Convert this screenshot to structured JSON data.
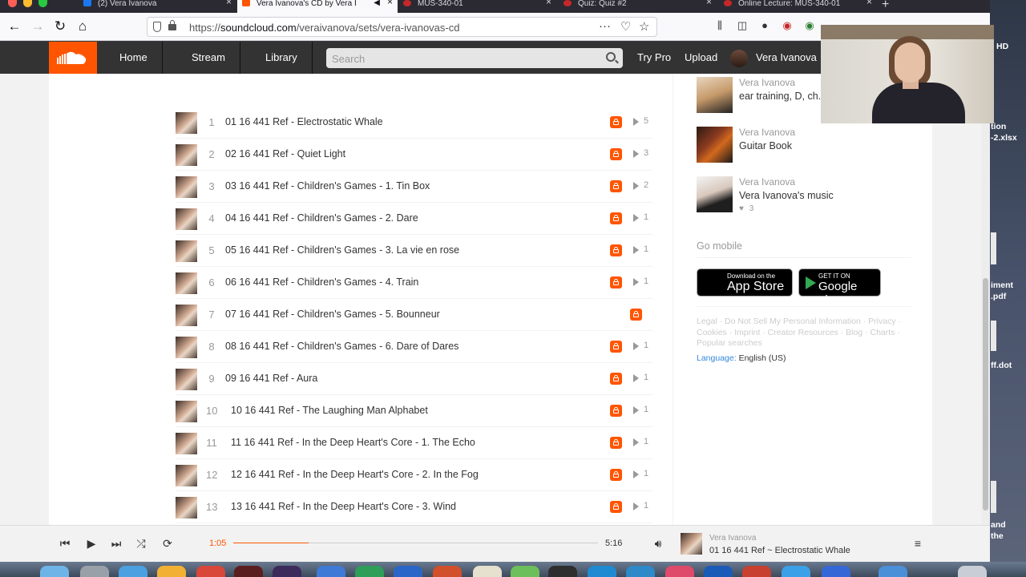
{
  "browser": {
    "tabs": [
      {
        "label": "(2) Vera Ivanova",
        "favicon_color": "#1877f2",
        "active": false
      },
      {
        "label": "Vera Ivanova's CD by Vera I",
        "favicon_color": "#f50",
        "active": true
      },
      {
        "label": "MUS-340-01",
        "favicon_color": "#c62828",
        "active": false
      },
      {
        "label": "Quiz: Quiz #2",
        "favicon_color": "#c62828",
        "active": false
      },
      {
        "label": "Online Lecture: MUS-340-01",
        "favicon_color": "#c62828",
        "active": false
      }
    ],
    "url_prefix": "https://",
    "url_domain": "soundcloud.com",
    "url_path": "/veraivanova/sets/vera-ivanovas-cd"
  },
  "header": {
    "nav": [
      "Home",
      "Stream",
      "Library"
    ],
    "search_placeholder": "Search",
    "try_pro": "Try Pro",
    "upload": "Upload",
    "username": "Vera Ivanova"
  },
  "tracks": [
    {
      "num": "1",
      "title": "01 16 441 Ref - Electrostatic Whale",
      "plays": "5",
      "private": true
    },
    {
      "num": "2",
      "title": "02 16 441 Ref - Quiet Light",
      "plays": "3",
      "private": true
    },
    {
      "num": "3",
      "title": "03 16 441 Ref - Children's Games - 1. Tin Box",
      "plays": "2",
      "private": true
    },
    {
      "num": "4",
      "title": "04 16 441 Ref - Children's Games - 2. Dare",
      "plays": "1",
      "private": true
    },
    {
      "num": "5",
      "title": "05 16 441 Ref - Children's Games - 3. La vie en rose",
      "plays": "1",
      "private": true
    },
    {
      "num": "6",
      "title": "06 16 441 Ref - Children's Games - 4. Train",
      "plays": "1",
      "private": true
    },
    {
      "num": "7",
      "title": "07 16 441 Ref - Children's Games - 5. Bounneur",
      "plays": "",
      "private": true
    },
    {
      "num": "8",
      "title": "08 16 441 Ref - Children's Games - 6. Dare of Dares",
      "plays": "1",
      "private": true
    },
    {
      "num": "9",
      "title": "09 16 441 Ref - Aura",
      "plays": "1",
      "private": true
    },
    {
      "num": "10",
      "title": "10 16 441 Ref - The Laughing Man Alphabet",
      "plays": "1",
      "private": true
    },
    {
      "num": "11",
      "title": "11 16 441 Ref - In the Deep Heart's Core - 1. The Echo",
      "plays": "1",
      "private": true
    },
    {
      "num": "12",
      "title": "12 16 441 Ref - In the Deep Heart's Core - 2. In the Fog",
      "plays": "1",
      "private": true
    },
    {
      "num": "13",
      "title": "13 16 441 Ref - In the Deep Heart's Core - 3. Wind",
      "plays": "1",
      "private": true
    }
  ],
  "sidebar": {
    "playlists": [
      {
        "user": "Vera Ivanova",
        "title": "ear training, D, ch.",
        "likes": ""
      },
      {
        "user": "Vera Ivanova",
        "title": "Guitar Book",
        "likes": ""
      },
      {
        "user": "Vera Ivanova",
        "title": "Vera Ivanova's music",
        "likes": "3"
      }
    ],
    "go_mobile": "Go mobile",
    "app_store_small": "Download on the",
    "app_store_big": "App Store",
    "google_small": "GET IT ON",
    "google_big": "Google play",
    "footer_links": "Legal · Do Not Sell My Personal Information · Privacy · Cookies · Imprint · Creator Resources · Blog · Charts · Popular searches",
    "language_label": "Language:",
    "language_value": "English (US)"
  },
  "player": {
    "elapsed": "1:05",
    "duration": "5:16",
    "progress_fraction": 0.206,
    "user": "Vera Ivanova",
    "title": "01 16 441 Ref ~ Electrostatic Whale"
  },
  "desktop": {
    "labels": [
      "HD",
      "tion",
      "-2.xlsx",
      "iment",
      ".pdf",
      "ff.dot",
      "and",
      "the"
    ]
  },
  "colors": {
    "accent": "#ff5500",
    "header_bg": "#333333"
  }
}
